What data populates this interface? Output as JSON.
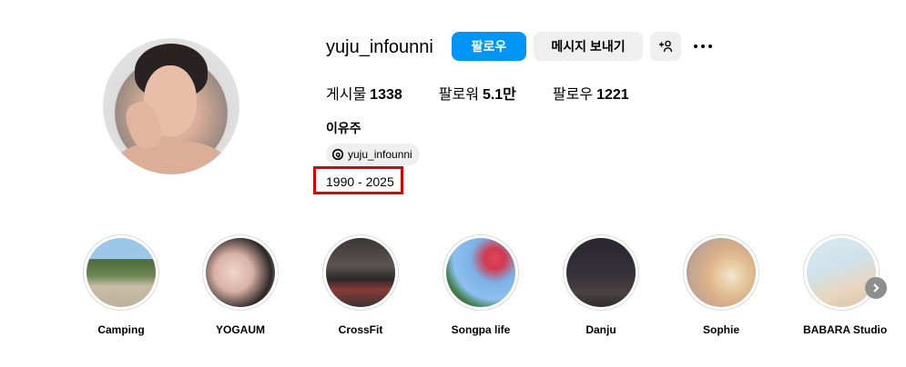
{
  "profile": {
    "username": "yuju_infounni",
    "follow_label": "팔로우",
    "message_label": "메시지 보내기",
    "full_name": "이유주",
    "threads_handle": "yuju_infounni",
    "years": "1990 - 2025"
  },
  "stats": {
    "posts_label": "게시물",
    "posts_value": "1338",
    "followers_label": "팔로워",
    "followers_value": "5.1만",
    "following_label": "팔로우",
    "following_value": "1221"
  },
  "highlights": [
    {
      "label": "Camping"
    },
    {
      "label": "YOGAUM"
    },
    {
      "label": "CrossFit"
    },
    {
      "label": "Songpa life"
    },
    {
      "label": "Danju"
    },
    {
      "label": "Sophie"
    },
    {
      "label": "BABARA Studio"
    }
  ],
  "colors": {
    "accent": "#0095f6",
    "button_secondary": "#efefef",
    "annotation_red": "#e00000"
  }
}
